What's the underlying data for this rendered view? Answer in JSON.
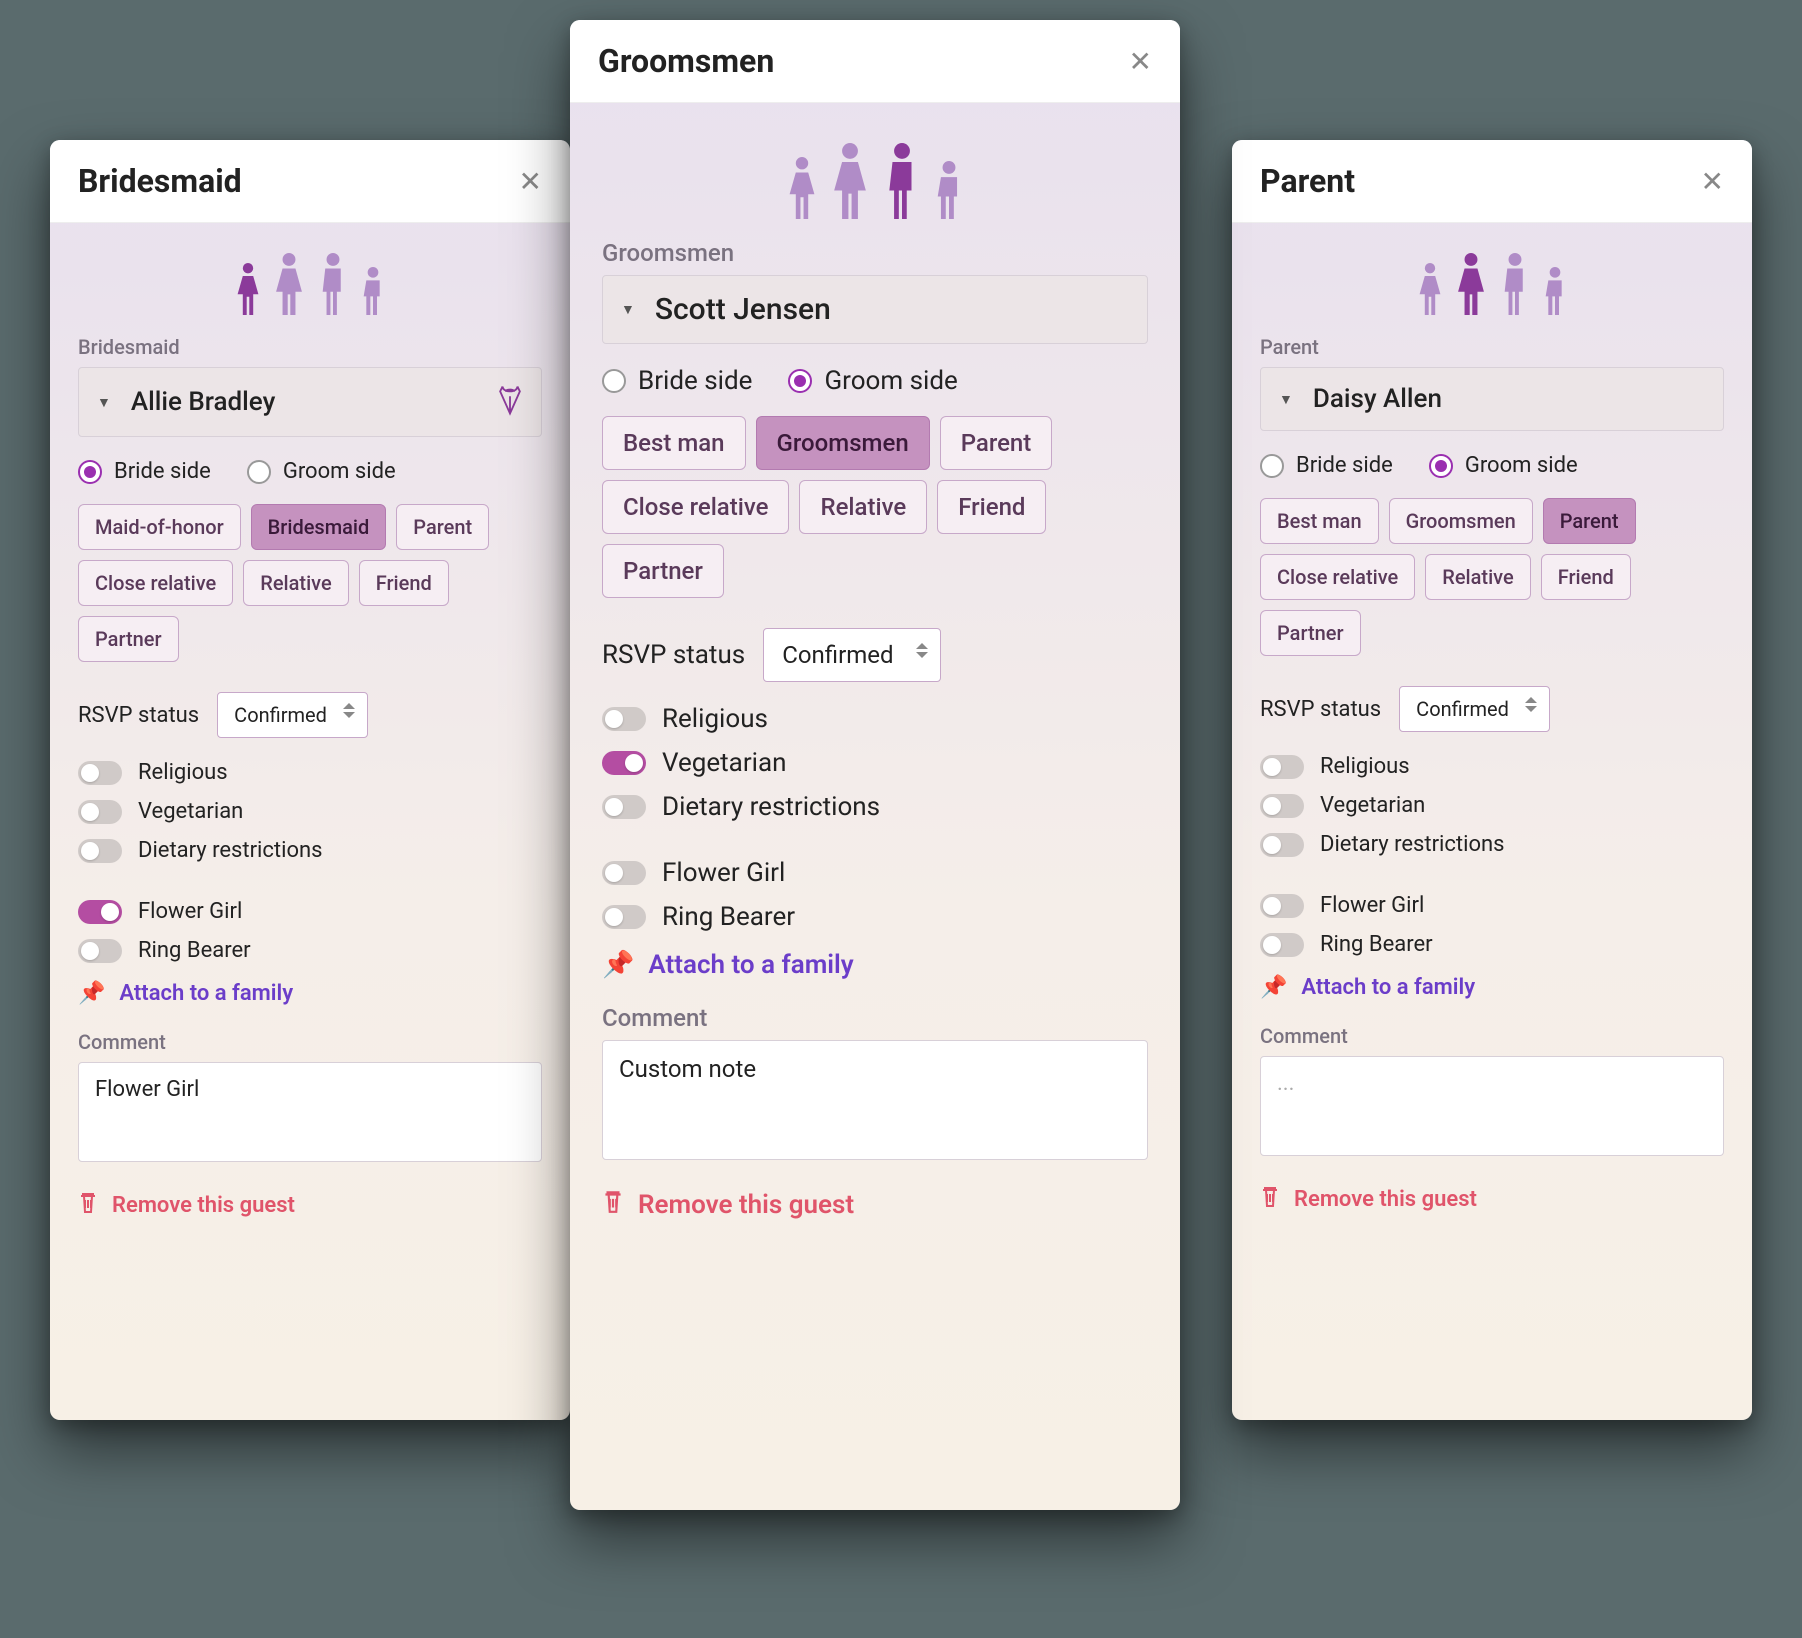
{
  "labels": {
    "role_label_bridesmaid": "Bridesmaid",
    "role_label_groomsmen": "Groomsmen",
    "role_label_parent": "Parent",
    "bride_side": "Bride side",
    "groom_side": "Groom side",
    "rsvp": "RSVP status",
    "rsvp_confirmed": "Confirmed",
    "religious": "Religious",
    "vegetarian": "Vegetarian",
    "dietary": "Dietary restrictions",
    "flower_girl": "Flower Girl",
    "ring_bearer": "Ring Bearer",
    "attach": "Attach to a family",
    "comment": "Comment",
    "remove": "Remove this guest",
    "placeholder": "..."
  },
  "chips": {
    "bride_side": [
      "Maid-of-honor",
      "Bridesmaid",
      "Parent",
      "Close relative",
      "Relative",
      "Friend",
      "Partner"
    ],
    "groom_side": [
      "Best man",
      "Groomsmen",
      "Parent",
      "Close relative",
      "Relative",
      "Friend",
      "Partner"
    ]
  },
  "cards": {
    "left": {
      "title": "Bridesmaid",
      "name": "Allie Bradley",
      "side": "bride",
      "active_chip": "Bridesmaid",
      "has_bouquet": true,
      "toggles": {
        "religious": false,
        "vegetarian": false,
        "dietary": false,
        "flower_girl": true,
        "ring_bearer": false
      },
      "comment": "Flower Girl"
    },
    "center": {
      "title": "Groomsmen",
      "name": "Scott Jensen",
      "side": "groom",
      "active_chip": "Groomsmen",
      "has_bouquet": false,
      "toggles": {
        "religious": false,
        "vegetarian": true,
        "dietary": false,
        "flower_girl": false,
        "ring_bearer": false
      },
      "comment": "Custom note"
    },
    "right": {
      "title": "Parent",
      "name": "Daisy Allen",
      "side": "groom",
      "active_chip": "Parent",
      "has_bouquet": false,
      "toggles": {
        "religious": false,
        "vegetarian": false,
        "dietary": false,
        "flower_girl": false,
        "ring_bearer": false
      },
      "comment": ""
    }
  },
  "colors": {
    "accent": "#9a2fb0",
    "chip_active": "#c592bf",
    "toggle_on": "#b44da2",
    "link": "#6b3dc9",
    "danger": "#e0546a"
  }
}
